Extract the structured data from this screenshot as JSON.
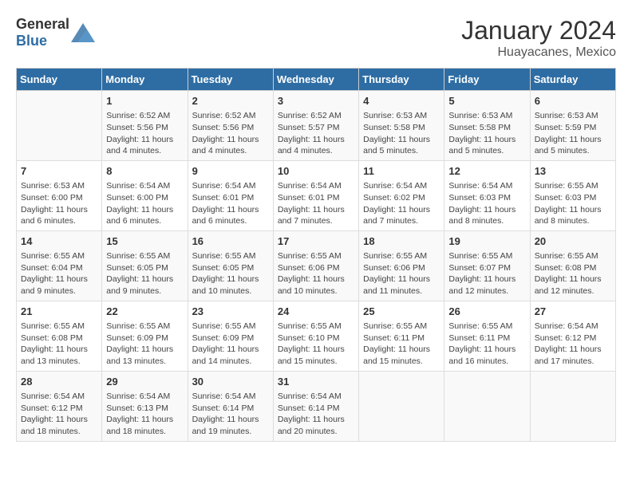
{
  "header": {
    "logo_general": "General",
    "logo_blue": "Blue",
    "title": "January 2024",
    "subtitle": "Huayacanes, Mexico"
  },
  "days_of_week": [
    "Sunday",
    "Monday",
    "Tuesday",
    "Wednesday",
    "Thursday",
    "Friday",
    "Saturday"
  ],
  "weeks": [
    [
      {
        "day": "",
        "info": ""
      },
      {
        "day": "1",
        "info": "Sunrise: 6:52 AM\nSunset: 5:56 PM\nDaylight: 11 hours\nand 4 minutes."
      },
      {
        "day": "2",
        "info": "Sunrise: 6:52 AM\nSunset: 5:56 PM\nDaylight: 11 hours\nand 4 minutes."
      },
      {
        "day": "3",
        "info": "Sunrise: 6:52 AM\nSunset: 5:57 PM\nDaylight: 11 hours\nand 4 minutes."
      },
      {
        "day": "4",
        "info": "Sunrise: 6:53 AM\nSunset: 5:58 PM\nDaylight: 11 hours\nand 5 minutes."
      },
      {
        "day": "5",
        "info": "Sunrise: 6:53 AM\nSunset: 5:58 PM\nDaylight: 11 hours\nand 5 minutes."
      },
      {
        "day": "6",
        "info": "Sunrise: 6:53 AM\nSunset: 5:59 PM\nDaylight: 11 hours\nand 5 minutes."
      }
    ],
    [
      {
        "day": "7",
        "info": "Sunrise: 6:53 AM\nSunset: 6:00 PM\nDaylight: 11 hours\nand 6 minutes."
      },
      {
        "day": "8",
        "info": "Sunrise: 6:54 AM\nSunset: 6:00 PM\nDaylight: 11 hours\nand 6 minutes."
      },
      {
        "day": "9",
        "info": "Sunrise: 6:54 AM\nSunset: 6:01 PM\nDaylight: 11 hours\nand 6 minutes."
      },
      {
        "day": "10",
        "info": "Sunrise: 6:54 AM\nSunset: 6:01 PM\nDaylight: 11 hours\nand 7 minutes."
      },
      {
        "day": "11",
        "info": "Sunrise: 6:54 AM\nSunset: 6:02 PM\nDaylight: 11 hours\nand 7 minutes."
      },
      {
        "day": "12",
        "info": "Sunrise: 6:54 AM\nSunset: 6:03 PM\nDaylight: 11 hours\nand 8 minutes."
      },
      {
        "day": "13",
        "info": "Sunrise: 6:55 AM\nSunset: 6:03 PM\nDaylight: 11 hours\nand 8 minutes."
      }
    ],
    [
      {
        "day": "14",
        "info": "Sunrise: 6:55 AM\nSunset: 6:04 PM\nDaylight: 11 hours\nand 9 minutes."
      },
      {
        "day": "15",
        "info": "Sunrise: 6:55 AM\nSunset: 6:05 PM\nDaylight: 11 hours\nand 9 minutes."
      },
      {
        "day": "16",
        "info": "Sunrise: 6:55 AM\nSunset: 6:05 PM\nDaylight: 11 hours\nand 10 minutes."
      },
      {
        "day": "17",
        "info": "Sunrise: 6:55 AM\nSunset: 6:06 PM\nDaylight: 11 hours\nand 10 minutes."
      },
      {
        "day": "18",
        "info": "Sunrise: 6:55 AM\nSunset: 6:06 PM\nDaylight: 11 hours\nand 11 minutes."
      },
      {
        "day": "19",
        "info": "Sunrise: 6:55 AM\nSunset: 6:07 PM\nDaylight: 11 hours\nand 12 minutes."
      },
      {
        "day": "20",
        "info": "Sunrise: 6:55 AM\nSunset: 6:08 PM\nDaylight: 11 hours\nand 12 minutes."
      }
    ],
    [
      {
        "day": "21",
        "info": "Sunrise: 6:55 AM\nSunset: 6:08 PM\nDaylight: 11 hours\nand 13 minutes."
      },
      {
        "day": "22",
        "info": "Sunrise: 6:55 AM\nSunset: 6:09 PM\nDaylight: 11 hours\nand 13 minutes."
      },
      {
        "day": "23",
        "info": "Sunrise: 6:55 AM\nSunset: 6:09 PM\nDaylight: 11 hours\nand 14 minutes."
      },
      {
        "day": "24",
        "info": "Sunrise: 6:55 AM\nSunset: 6:10 PM\nDaylight: 11 hours\nand 15 minutes."
      },
      {
        "day": "25",
        "info": "Sunrise: 6:55 AM\nSunset: 6:11 PM\nDaylight: 11 hours\nand 15 minutes."
      },
      {
        "day": "26",
        "info": "Sunrise: 6:55 AM\nSunset: 6:11 PM\nDaylight: 11 hours\nand 16 minutes."
      },
      {
        "day": "27",
        "info": "Sunrise: 6:54 AM\nSunset: 6:12 PM\nDaylight: 11 hours\nand 17 minutes."
      }
    ],
    [
      {
        "day": "28",
        "info": "Sunrise: 6:54 AM\nSunset: 6:12 PM\nDaylight: 11 hours\nand 18 minutes."
      },
      {
        "day": "29",
        "info": "Sunrise: 6:54 AM\nSunset: 6:13 PM\nDaylight: 11 hours\nand 18 minutes."
      },
      {
        "day": "30",
        "info": "Sunrise: 6:54 AM\nSunset: 6:14 PM\nDaylight: 11 hours\nand 19 minutes."
      },
      {
        "day": "31",
        "info": "Sunrise: 6:54 AM\nSunset: 6:14 PM\nDaylight: 11 hours\nand 20 minutes."
      },
      {
        "day": "",
        "info": ""
      },
      {
        "day": "",
        "info": ""
      },
      {
        "day": "",
        "info": ""
      }
    ]
  ]
}
